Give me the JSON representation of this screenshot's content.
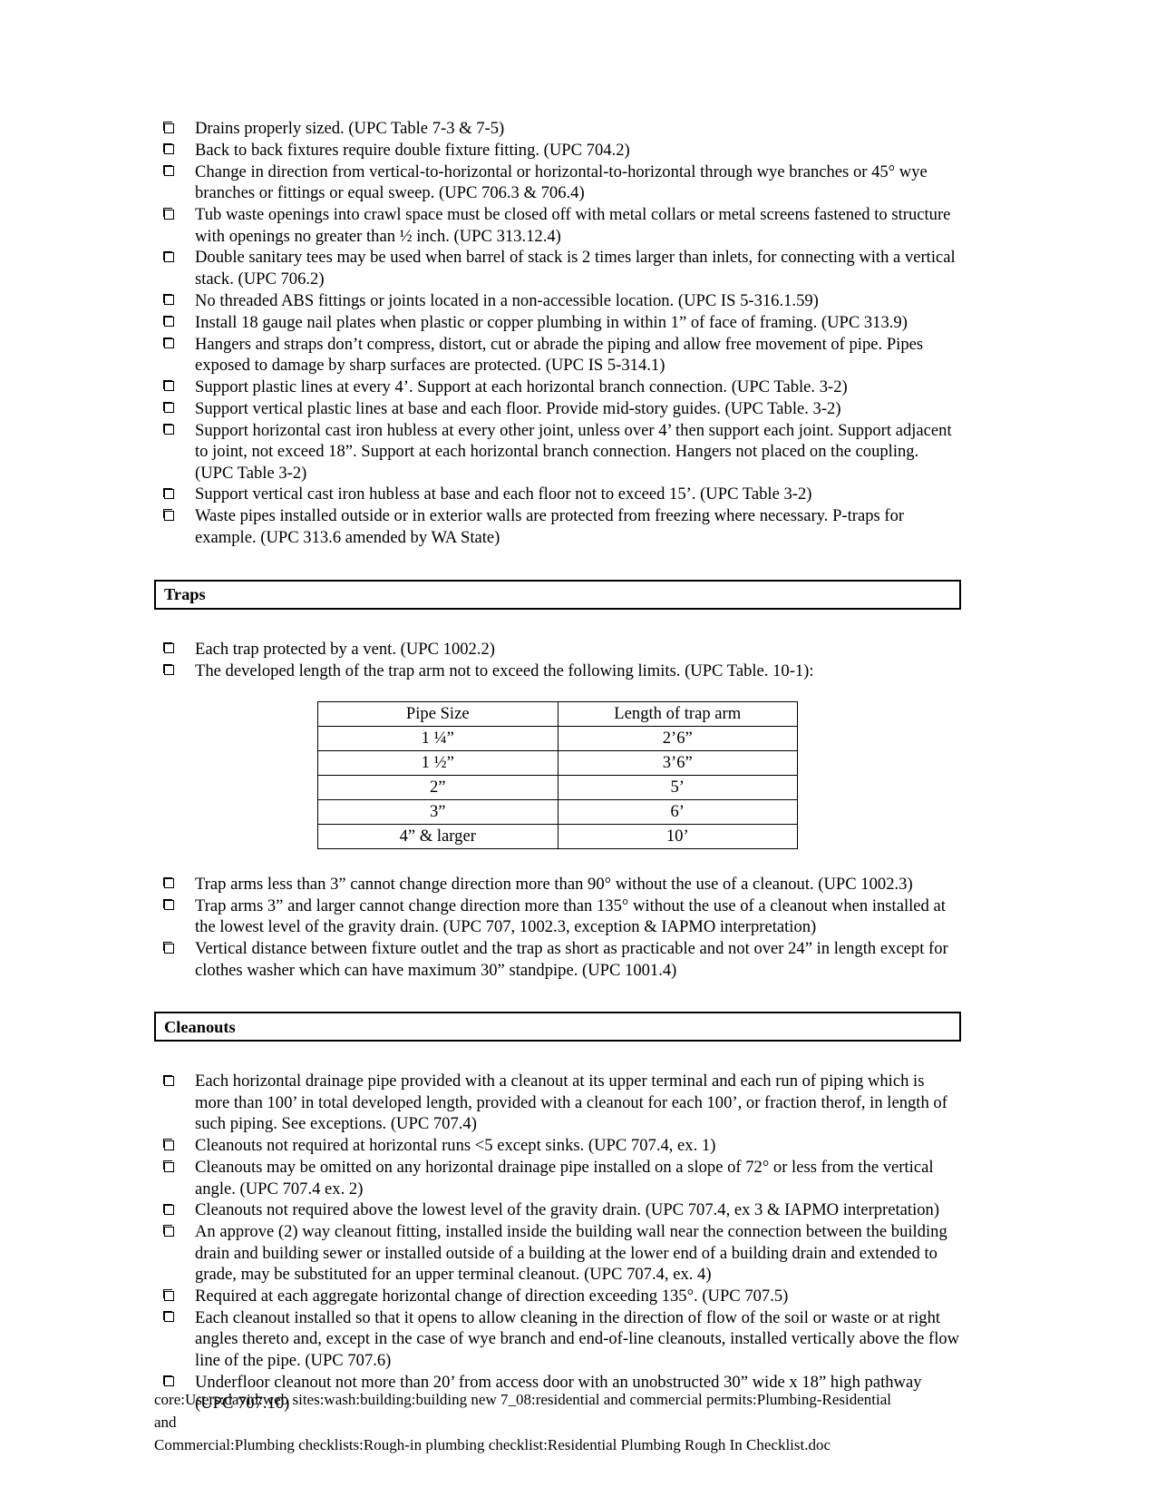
{
  "document": {
    "type": "plumbing-rough-in-checklist-page",
    "sections": [
      {
        "id": "drainage-continued",
        "has_header_bar": false,
        "header": "",
        "items": [
          "Drains properly sized. (UPC Table 7-3 & 7-5)",
          "Back to back fixtures require double fixture fitting. (UPC 704.2)",
          "Change in direction from vertical-to-horizontal or horizontal-to-horizontal through wye branches or 45° wye branches or fittings or equal sweep. (UPC 706.3 & 706.4)",
          "Tub waste openings into crawl space must be closed off with metal collars or metal screens fastened to structure with openings no greater than ½ inch. (UPC 313.12.4)",
          "Double sanitary tees may be used when barrel of stack is 2 times larger than inlets, for connecting with a vertical stack. (UPC 706.2)",
          "No threaded ABS fittings or joints located in a non-accessible location. (UPC IS 5-316.1.59)",
          "Install 18 gauge nail plates when plastic or copper plumbing in within 1” of face of framing. (UPC 313.9)",
          "Hangers and straps don’t compress, distort, cut or abrade the piping and allow free movement of pipe. Pipes exposed to damage by sharp surfaces are protected. (UPC IS 5-314.1)",
          "Support plastic lines at every 4’. Support at each horizontal branch connection. (UPC Table. 3-2)",
          "Support vertical plastic lines at base and each floor. Provide mid-story guides. (UPC Table. 3-2)",
          "Support horizontal cast iron hubless at every other joint, unless over 4’ then support each joint. Support adjacent to joint, not exceed 18”. Support at each horizontal branch connection. Hangers not placed on the coupling. (UPC Table 3-2)",
          "Support vertical cast iron hubless at base and each floor not to exceed 15’. (UPC Table 3-2)",
          "Waste pipes installed outside or in exterior walls are protected from freezing where necessary. P-traps for example. (UPC 313.6 amended by WA State)"
        ]
      },
      {
        "id": "traps",
        "has_header_bar": true,
        "header": "Traps",
        "items": [
          "Each trap protected by a vent. (UPC 1002.2)",
          "The developed length of the trap arm not to exceed the following limits. (UPC Table. 10-1):"
        ],
        "items_after_table": [
          "Trap arms less than 3” cannot change direction more than 90° without the use of a cleanout. (UPC 1002.3)",
          "Trap arms 3” and larger cannot change direction more than 135° without the use of a cleanout when installed at the lowest level of the gravity drain. (UPC 707, 1002.3, exception & IAPMO interpretation)",
          "Vertical distance between fixture outlet and the trap as short as practicable and not over 24” in length except for clothes washer which can have maximum 30” standpipe. (UPC 1001.4)"
        ]
      },
      {
        "id": "cleanouts",
        "has_header_bar": true,
        "header": "Cleanouts",
        "items": [
          "Each horizontal drainage pipe provided with a cleanout at its upper terminal and each run of piping which is more than 100’ in total developed length, provided with a cleanout for each 100’, or fraction therof, in length of such piping. See exceptions. (UPC 707.4)",
          "Cleanouts not required at horizontal runs <5 except sinks. (UPC 707.4, ex. 1)",
          "Cleanouts may be omitted on any horizontal drainage pipe installed on a slope of 72° or less from the vertical angle. (UPC 707.4 ex. 2)",
          "Cleanouts not required above the lowest level of the gravity drain. (UPC 707.4, ex 3 & IAPMO interpretation)",
          "An approve (2) way cleanout fitting, installed inside the building wall near the connection between the building drain and building sewer or installed outside of a building at the lower end of a building drain and extended to grade, may be substituted for an upper terminal cleanout. (UPC 707.4, ex. 4)",
          "Required at each aggregate horizontal change of direction exceeding 135°. (UPC 707.5)",
          "Each cleanout installed so that it opens to allow cleaning in the direction of flow of the soil or waste or at right angles thereto and, except in the case of wye branch and end-of-line cleanouts, installed vertically above the flow line of the pipe. (UPC 707.6)",
          "Underfloor cleanout not more than 20’ from access door with an unobstructed 30” wide x 18” high pathway (UPC 707.10)"
        ]
      }
    ],
    "trap_table": {
      "headers": [
        "Pipe Size",
        "Length of trap arm"
      ],
      "rows": [
        [
          "1 ¼”",
          "2’6”"
        ],
        [
          "1 ½”",
          "3’6”"
        ],
        [
          "2”",
          "5’"
        ],
        [
          "3”",
          "6’"
        ],
        [
          "4” & larger",
          "10’"
        ]
      ]
    },
    "footer": {
      "line1": "core:Users:david:web sites:wash:building:building new 7_08:residential and commercial permits:Plumbing-Residential and",
      "line2": "Commercial:Plumbing checklists:Rough-in plumbing checklist:Residential Plumbing Rough In Checklist.doc"
    }
  }
}
